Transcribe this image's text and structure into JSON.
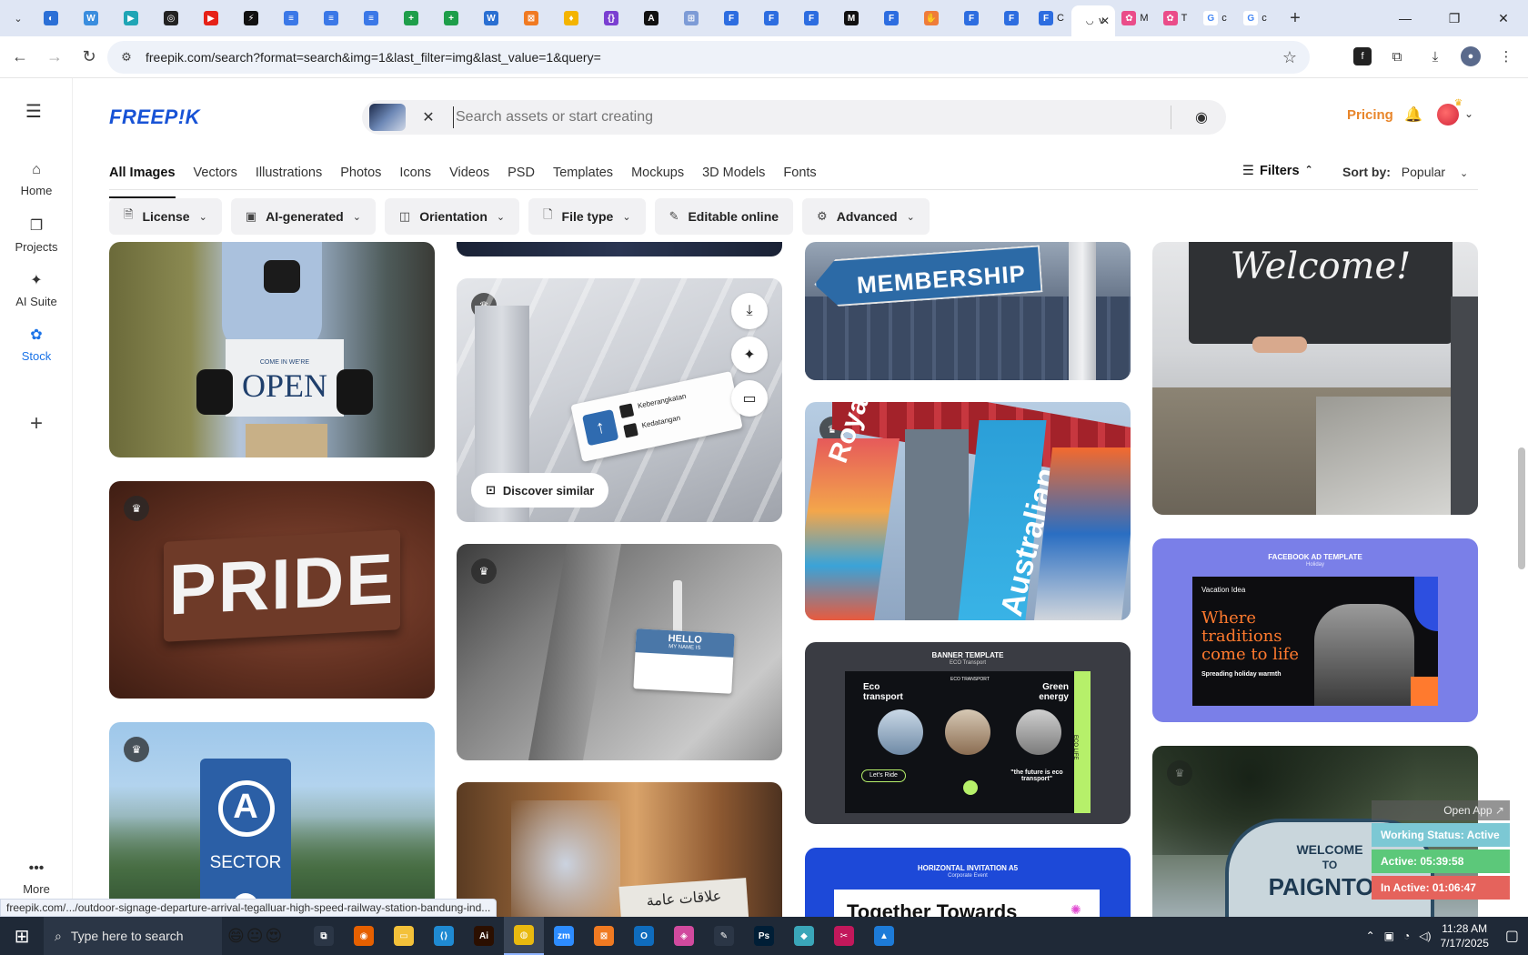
{
  "browser": {
    "tabs": [
      {
        "color": "#2b6fd6",
        "glyph": "◐"
      },
      {
        "color": "#3a8dde",
        "glyph": "W"
      },
      {
        "color": "#1fa5b5",
        "glyph": "▶"
      },
      {
        "color": "#222222",
        "glyph": "◎"
      },
      {
        "color": "#e62117",
        "glyph": "▶"
      },
      {
        "color": "#111111",
        "glyph": "⚡"
      },
      {
        "color": "#3b78e7",
        "glyph": "≡"
      },
      {
        "color": "#3b78e7",
        "glyph": "≡"
      },
      {
        "color": "#3b78e7",
        "glyph": "≡"
      },
      {
        "color": "#1e9e4a",
        "glyph": "+"
      },
      {
        "color": "#1e9e4a",
        "glyph": "+"
      },
      {
        "color": "#2a6fd2",
        "glyph": "W"
      },
      {
        "color": "#f07a22",
        "glyph": "⊠"
      },
      {
        "color": "#f4b400",
        "glyph": "♦"
      },
      {
        "color": "#7a3fd1",
        "glyph": "{}"
      },
      {
        "color": "#111111",
        "glyph": "A"
      },
      {
        "color": "#7d9bd6",
        "glyph": "⊞"
      },
      {
        "color": "#2d6de0",
        "glyph": "F"
      },
      {
        "color": "#2d6de0",
        "glyph": "F"
      },
      {
        "color": "#2d6de0",
        "glyph": "F"
      },
      {
        "color": "#111111",
        "glyph": "M"
      },
      {
        "color": "#2d6de0",
        "glyph": "F"
      },
      {
        "color": "#ef7c3a",
        "glyph": "✋"
      },
      {
        "color": "#2d6de0",
        "glyph": "F"
      },
      {
        "color": "#2d6de0",
        "glyph": "F"
      }
    ],
    "tab_labels": {
      "tab24": "C",
      "active": "v",
      "after1": "M",
      "after2": "T",
      "after3": "c",
      "after4": "c"
    },
    "url": "freepik.com/search?format=search&img=1&last_filter=img&last_value=1&query=",
    "status_url": "freepik.com/.../outdoor-signage-departure-arrival-tegalluar-high-speed-railway-station-bandung-ind..."
  },
  "freepik": {
    "logo": "FREEP!K",
    "search_placeholder": "Search assets or start creating",
    "pricing": "Pricing",
    "leftnav": [
      {
        "label": "Home",
        "icon": "home-icon",
        "glyph": "⌂"
      },
      {
        "label": "Projects",
        "icon": "projects-icon",
        "glyph": "❐"
      },
      {
        "label": "AI Suite",
        "icon": "ai-suite-icon",
        "glyph": "✦"
      },
      {
        "label": "Stock",
        "icon": "stock-icon",
        "glyph": "✿"
      }
    ],
    "more_label": "More",
    "categories": [
      "All Images",
      "Vectors",
      "Illustrations",
      "Photos",
      "Icons",
      "Videos",
      "PSD",
      "Templates",
      "Mockups",
      "3D Models",
      "Fonts"
    ],
    "filters_label": "Filters",
    "sort_label": "Sort by:",
    "sort_value": "Popular",
    "pills": [
      {
        "label": "License",
        "glyph": "🗎"
      },
      {
        "label": "AI-generated",
        "glyph": "▣"
      },
      {
        "label": "Orientation",
        "glyph": "◫"
      },
      {
        "label": "File type",
        "glyph": "🗋"
      },
      {
        "label": "Editable online",
        "glyph": "✎"
      },
      {
        "label": "Advanced",
        "glyph": "⚙"
      }
    ],
    "discover_similar": "Discover similar"
  },
  "cards": {
    "open_sign": {
      "line1": "COME IN WE'RE",
      "line2": "OPEN"
    },
    "pride": "PRIDE",
    "sector": {
      "letter": "A",
      "word": "SECTOR"
    },
    "station": {
      "line1": "Keberangkatan",
      "line2": "Kedatangan"
    },
    "badge": {
      "line1": "HELLO",
      "line2": "MY NAME IS"
    },
    "arabic": "علاقات عامة",
    "membership": "MEMBERSHIP",
    "royal": "Royal",
    "australian": "Australian",
    "banner": {
      "title": "BANNER TEMPLATE",
      "subtitle": "ECO Transport",
      "left": "Eco transport",
      "right": "Green energy",
      "center": "ECO TRANSPORT",
      "cta": "Let's Ride",
      "quote": "\"the future is eco transport\"",
      "side": "ECO LIFE"
    },
    "invitation": {
      "title": "HORIZONTAL INVITATION A5",
      "subtitle": "Corporate Event",
      "headline": "Together Towards"
    },
    "welcome": "Welcome!",
    "fb_ad": {
      "title": "FACEBOOK AD TEMPLATE",
      "subtitle": "Holiday",
      "brand": "Vacation Idea",
      "headline": "Where traditions come to life",
      "tagline": "Spreading holiday warmth"
    },
    "paignton": {
      "line1": "WELCOME",
      "line2": "TO",
      "line3": "PAIGNTON"
    }
  },
  "widget": {
    "open_app": "Open App ↗",
    "working_status": "Working Status: Active",
    "active": "Active: 05:39:58",
    "inactive": "In Active: 01:06:47"
  },
  "taskbar": {
    "search_placeholder": "Type here to search",
    "time": "11:28 AM",
    "date": "7/17/2025",
    "apps": [
      {
        "name": "task-view",
        "color": "#2b3646",
        "glyph": "⧉"
      },
      {
        "name": "firefox",
        "color": "#e66000",
        "glyph": "◉"
      },
      {
        "name": "file-explorer",
        "color": "#f3c13a",
        "glyph": "▭"
      },
      {
        "name": "vscode",
        "color": "#1f8ad2",
        "glyph": "⟨⟩"
      },
      {
        "name": "illustrator",
        "color": "#2b0f00",
        "glyph": "Ai"
      },
      {
        "name": "chrome",
        "color": "#e9b90f",
        "glyph": "◍"
      },
      {
        "name": "zoom",
        "color": "#2d8cff",
        "glyph": "zm"
      },
      {
        "name": "app-orange",
        "color": "#f07a22",
        "glyph": "⊠"
      },
      {
        "name": "outlook",
        "color": "#0f6cbd",
        "glyph": "O"
      },
      {
        "name": "app-gradient",
        "color": "#d14a9e",
        "glyph": "◈"
      },
      {
        "name": "pen-tool",
        "color": "#2b3646",
        "glyph": "✎"
      },
      {
        "name": "photoshop",
        "color": "#001e36",
        "glyph": "Ps"
      },
      {
        "name": "app-teal",
        "color": "#3aa6b9",
        "glyph": "◆"
      },
      {
        "name": "snipping",
        "color": "#c2185b",
        "glyph": "✂"
      },
      {
        "name": "app-blue",
        "color": "#1d7bd8",
        "glyph": "▲"
      }
    ]
  }
}
